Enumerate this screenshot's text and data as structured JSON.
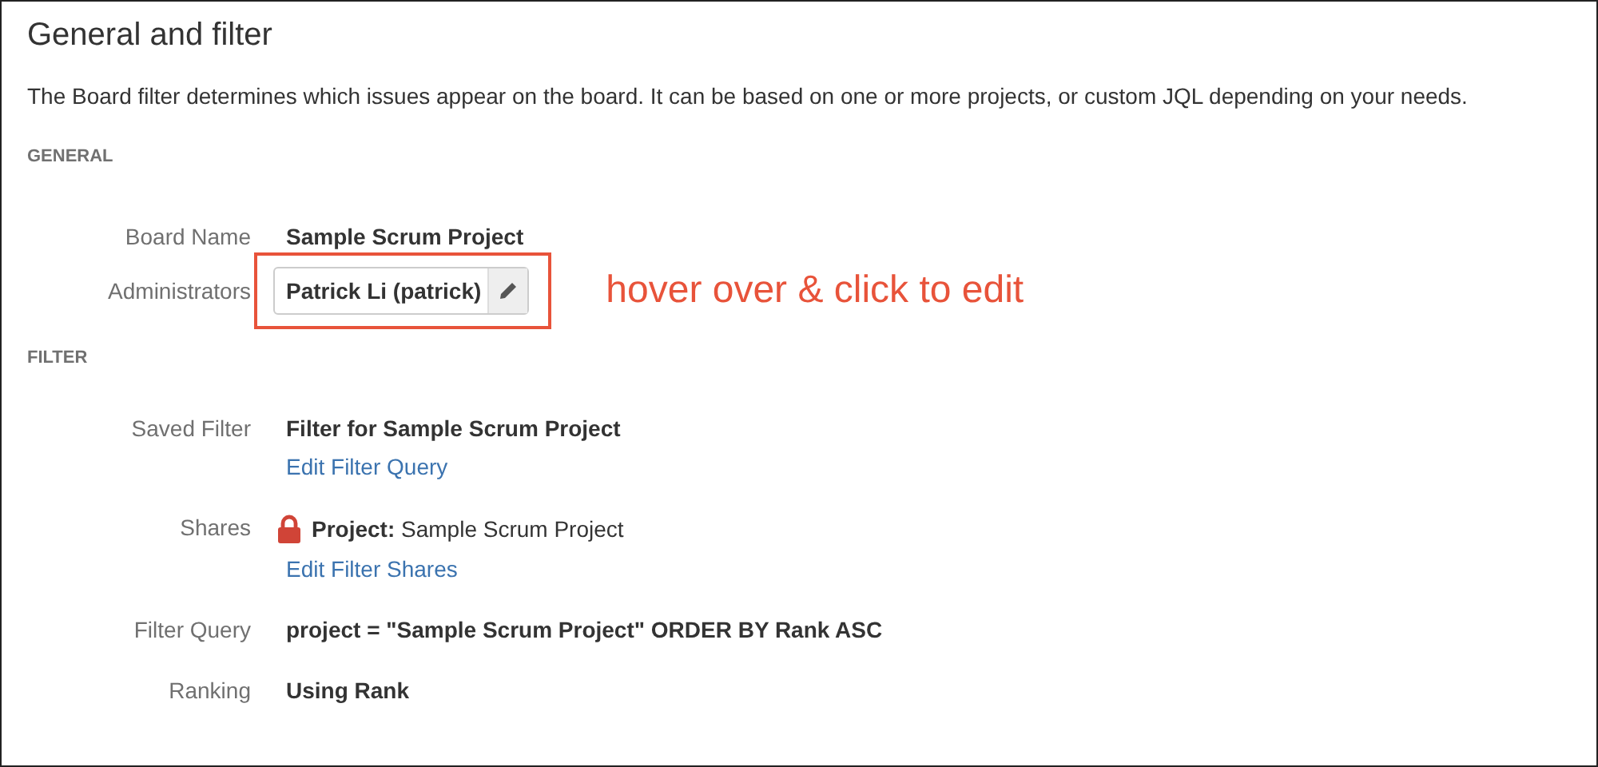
{
  "title": "General and filter",
  "description": "The Board filter determines which issues appear on the board. It can be based on one or more projects, or custom JQL depending on your needs.",
  "sections": [
    {
      "heading": "GENERAL",
      "rows": [
        {
          "kind": "text",
          "label": "Board Name",
          "value": "Sample Scrum Project"
        },
        {
          "kind": "editable",
          "label": "Administrators",
          "value": "Patrick Li (patrick)",
          "annotation": "hover over & click to edit"
        }
      ]
    },
    {
      "heading": "FILTER",
      "rows": [
        {
          "kind": "text",
          "label": "Saved Filter",
          "value": "Filter for Sample Scrum Project",
          "link": "Edit Filter Query"
        },
        {
          "kind": "share",
          "label": "Shares",
          "prefix": "Project:",
          "value": "Sample Scrum Project",
          "link": "Edit Filter Shares"
        },
        {
          "kind": "text",
          "label": "Filter Query",
          "value": "project = \"Sample Scrum Project\" ORDER BY Rank ASC"
        },
        {
          "kind": "text",
          "label": "Ranking",
          "value": "Using Rank"
        }
      ]
    }
  ]
}
